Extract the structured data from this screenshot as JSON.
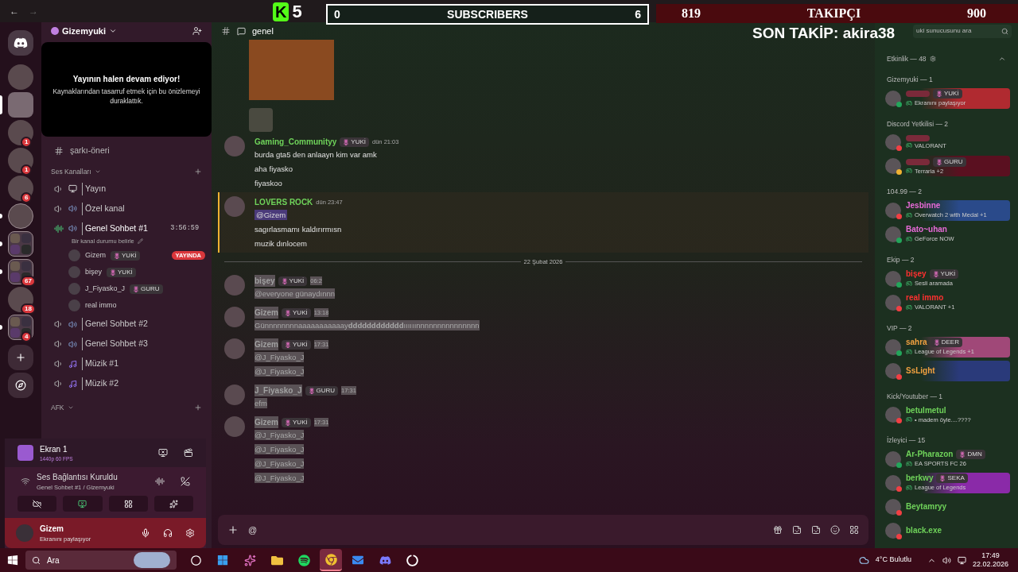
{
  "nav": {
    "back": "←",
    "forward": "→"
  },
  "overlay": {
    "logo": "K",
    "logo_count": "5",
    "subscribers": {
      "start": "0",
      "label": "SUBSCRIBERS",
      "goal": "6"
    },
    "followers": {
      "start": "819",
      "label": "TAKIPÇI",
      "goal": "900"
    },
    "last_follow": "SON TAKİP: akira38"
  },
  "servers": [
    {
      "kind": "server",
      "selected": false,
      "unread": false
    },
    {
      "kind": "server",
      "selected": true,
      "unread": false
    },
    {
      "kind": "server",
      "selected": false,
      "badge": "1",
      "unread": false
    },
    {
      "kind": "server",
      "selected": false,
      "badge": "1",
      "unread": false
    },
    {
      "kind": "server",
      "selected": false,
      "badge": "6",
      "unread": false
    },
    {
      "kind": "server",
      "selected": false,
      "unread": true
    },
    {
      "kind": "folder",
      "selected": false,
      "unread": true
    },
    {
      "kind": "folder",
      "selected": false,
      "badge": "67",
      "unread": true
    },
    {
      "kind": "server",
      "selected": false,
      "badge": "18",
      "unread": false
    },
    {
      "kind": "folder",
      "selected": false,
      "badge": "4",
      "unread": true
    }
  ],
  "sidebar": {
    "server_name": "Gizemyuki",
    "stream_preview": {
      "title": "Yayının halen devam ediyor!",
      "text": "Kaynaklarından tasarruf etmek için bu önizlemeyi duraklattık."
    },
    "text_channels": [
      {
        "name": "şarkı-öneri"
      }
    ],
    "voice_category": "Ses Kanalları",
    "voice_channels": [
      {
        "name": "Yayın",
        "kind": "screen",
        "active": false
      },
      {
        "name": "Özel kanal",
        "kind": "speaker",
        "active": false
      },
      {
        "name": "Genel Sohbet #1",
        "kind": "speaker",
        "active": true,
        "timer": "3:56:59",
        "status": "Bir kanal durumu belirle",
        "members": [
          {
            "name": "Gizem",
            "role": "YUKİ",
            "live": "YAYINDA"
          },
          {
            "name": "bişey",
            "role": "YUKİ"
          },
          {
            "name": "J_Fiyasko_J",
            "role": "GURU"
          },
          {
            "name": "real immo"
          }
        ]
      },
      {
        "name": "Genel Sohbet #2",
        "kind": "speaker",
        "active": false
      },
      {
        "name": "Genel Sohbet #3",
        "kind": "speaker",
        "active": false
      },
      {
        "name": "Müzik #1",
        "kind": "music",
        "active": false
      },
      {
        "name": "Müzik #2",
        "kind": "music",
        "active": false
      }
    ],
    "afk_category": "AFK",
    "stream_panel": {
      "title": "Ekran 1",
      "quality": "1440p 60 FPS"
    },
    "voice_panel": {
      "title": "Ses Bağlantısı Kuruldu",
      "channel": "Genel Sohbet #1 / Gizemyuki"
    },
    "user_panel": {
      "name": "Gizem",
      "status": "Ekranını paylaşıyor"
    }
  },
  "chat": {
    "channel": "genel",
    "messages": [
      {
        "kind": "attachments"
      },
      {
        "kind": "message",
        "author": "Gaming_Communityy",
        "color": "#6fd35a",
        "role": "YUKİ",
        "time": "dün 21:03",
        "mentioned": false,
        "selected": false,
        "lines": [
          "burda gta5 den anlaayn kim var amk",
          "aha fiyasko",
          "fiyaskoo"
        ]
      },
      {
        "kind": "message",
        "author": "LOVERS ROCK",
        "color": "#6fd35a",
        "time": "dün 23:47",
        "mentioned": true,
        "selected": false,
        "lines": [
          "@Gizem",
          "sagırlasmamı kaldırırmısn",
          "muzik dınlocem"
        ]
      },
      {
        "kind": "divider",
        "text": "22 Şubat 2026"
      },
      {
        "kind": "message",
        "author": "bişey",
        "role": "YUKİ",
        "time": "06:2",
        "mentioned": false,
        "selected": true,
        "lines": [
          "@everyone günaydınnn"
        ]
      },
      {
        "kind": "message",
        "author": "Gizem",
        "role": "YUKİ",
        "time": "13:18",
        "mentioned": false,
        "selected": true,
        "lines": [
          "Günnnnnnnnaaaaaaaaaaay**dddddddddddd**ıııııınnnnnnnnnnnnnnn"
        ]
      },
      {
        "kind": "message",
        "author": "Gizem",
        "role": "YUKİ",
        "time": "17:31",
        "mentioned": false,
        "selected": true,
        "lines": [
          "@J_Fiyasko_J",
          "@J_Fiyasko_J"
        ]
      },
      {
        "kind": "message",
        "author": "J_Fiyasko_J",
        "role": "GURU",
        "time": "17:31",
        "mentioned": false,
        "selected": true,
        "lines": [
          "efm"
        ]
      },
      {
        "kind": "message",
        "author": "Gizem",
        "role": "YUKİ",
        "time": "17:31",
        "mentioned": false,
        "selected": true,
        "lines": [
          "@J_Fiyasko_J",
          "@J_Fiyasko_J",
          "@J_Fiyasko_J",
          "@J_Fiyasko_J"
        ]
      }
    ],
    "input": {
      "value": "@"
    }
  },
  "members": {
    "search": {
      "placeholder": "uki sunucusunu ara"
    },
    "activity": "Etkinlik — 48",
    "groups": [
      {
        "title": "Gizemyuki — 1",
        "members": [
          {
            "role": "YUKİ",
            "activity": "Ekranını paylaşıyor",
            "kind": "online",
            "color": "#b02a30"
          }
        ]
      },
      {
        "title": "Discord Yetkilisi — 2",
        "members": [
          {
            "activity": "VALORANT",
            "kind": "dnd"
          },
          {
            "role": "GURU",
            "activity": "Terraria +2",
            "kind": "idle",
            "color": "#5a1020"
          }
        ]
      },
      {
        "title": "104.99 — 2",
        "color": "#e86ad8",
        "members": [
          {
            "name": "Jesbinne",
            "activity": "Overwatch 2 with Medal +1",
            "kind": "dnd",
            "color": "#2a4a8a"
          },
          {
            "name": "Bato~uhan",
            "activity": "GeForce NOW",
            "kind": "online"
          }
        ]
      },
      {
        "title": "Ekip — 2",
        "color": "#ff3030",
        "members": [
          {
            "name": "bişey",
            "role": "YUKİ",
            "activity": "Sesli aramada",
            "kind": "online"
          },
          {
            "name": "real immo",
            "activity": "VALORANT +1",
            "kind": "dnd"
          }
        ]
      },
      {
        "title": "VIP — 2",
        "color": "#f0a040",
        "members": [
          {
            "name": "sahra",
            "role": "DEER",
            "activity": "League of Legends +1",
            "kind": "online",
            "color": "#a04878"
          },
          {
            "name": "SsLight",
            "kind": "dnd",
            "color": "#2a3a7a"
          }
        ]
      },
      {
        "title": "Kick/Youtuber — 1",
        "color": "#6fd35a",
        "members": [
          {
            "name": "betulmetul",
            "activity": "• madem öyle....????",
            "kind": "dnd"
          }
        ]
      },
      {
        "title": "İzleyici — 15",
        "color": "#6fd35a",
        "members": [
          {
            "name": "Ar-Pharazon",
            "role": "DMN",
            "activity": "EA SPORTS FC 26",
            "kind": "online"
          },
          {
            "name": "berkwy",
            "role": "SEKA",
            "activity": "League of Legends",
            "kind": "dnd",
            "color": "#8a2aa8"
          },
          {
            "name": "Beytamryy",
            "kind": "dnd"
          },
          {
            "name": "black.exe",
            "kind": "dnd"
          }
        ]
      }
    ]
  },
  "taskbar": {
    "search": "Ara",
    "apps": [
      {
        "kind": "taskview",
        "active": false
      },
      {
        "kind": "store",
        "active": false
      },
      {
        "kind": "copilot",
        "active": false
      },
      {
        "kind": "folder",
        "active": false
      },
      {
        "kind": "music",
        "active": false
      },
      {
        "kind": "browser",
        "active": true
      },
      {
        "kind": "mail",
        "active": false
      },
      {
        "kind": "chat",
        "active": false
      },
      {
        "kind": "recorder",
        "active": false
      }
    ],
    "weather": "4°C Bulutlu",
    "time": "17:49",
    "date": "22.02.2026"
  }
}
